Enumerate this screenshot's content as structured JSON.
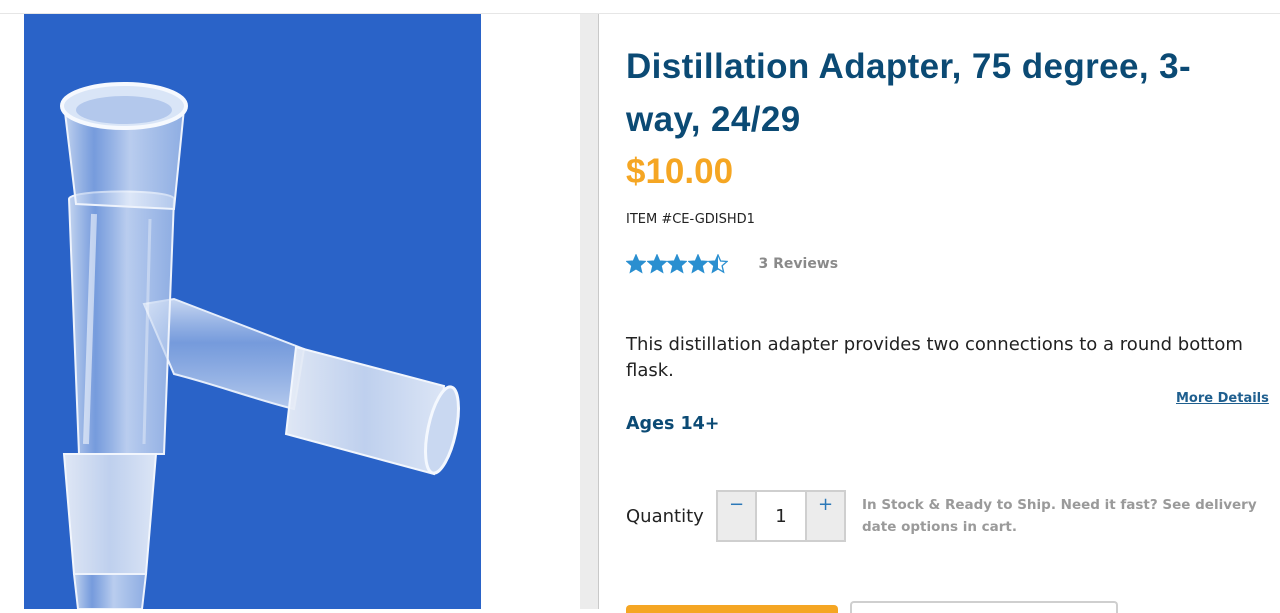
{
  "product": {
    "title": "Distillation Adapter, 75 degree, 3-way, 24/29",
    "price": "$10.00",
    "item_number": "ITEM #CE-GDISHD1",
    "rating": {
      "value": 4.5,
      "max": 5,
      "reviews_label": "3 Reviews"
    },
    "description": "This distillation adapter provides two connections to a round bottom flask.",
    "more_details_label": "More Details",
    "ages": "Ages 14+"
  },
  "quantity": {
    "label": "Quantity",
    "value": "1",
    "decrement_icon": "minus-icon",
    "increment_icon": "plus-icon",
    "decrement_glyph": "−",
    "increment_glyph": "+"
  },
  "stock_note": "In Stock & Ready to Ship. Need it fast? See delivery date options in cart.",
  "colors": {
    "title": "#0b4a74",
    "price": "#f5a623",
    "star": "#2a8fd0",
    "image_background": "#2a63c8"
  }
}
